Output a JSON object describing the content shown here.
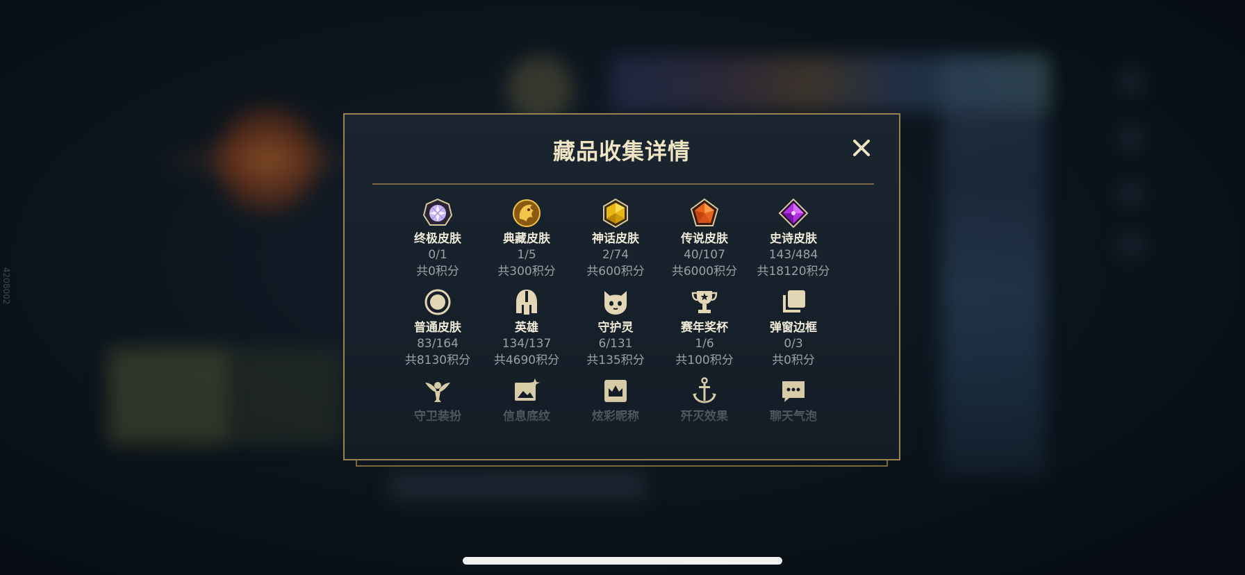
{
  "side_label": "4208002",
  "modal": {
    "title": "藏品收集详情",
    "close_icon": "close-icon"
  },
  "rows": [
    [
      {
        "icon": "ultimate-skin-gem-icon",
        "label": "终极皮肤",
        "count": "0/1",
        "points": "共0积分"
      },
      {
        "icon": "prestige-skin-dragon-icon",
        "label": "典藏皮肤",
        "count": "1/5",
        "points": "共300积分"
      },
      {
        "icon": "mythic-skin-gem-icon",
        "label": "神话皮肤",
        "count": "2/74",
        "points": "共600积分"
      },
      {
        "icon": "legendary-skin-gem-icon",
        "label": "传说皮肤",
        "count": "40/107",
        "points": "共6000积分"
      },
      {
        "icon": "epic-skin-gem-icon",
        "label": "史诗皮肤",
        "count": "143/484",
        "points": "共18120积分"
      }
    ],
    [
      {
        "icon": "standard-skin-circle-icon",
        "label": "普通皮肤",
        "count": "83/164",
        "points": "共8130积分"
      },
      {
        "icon": "champion-helmet-icon",
        "label": "英雄",
        "count": "134/137",
        "points": "共4690积分"
      },
      {
        "icon": "guardian-spirit-icon",
        "label": "守护灵",
        "count": "6/131",
        "points": "共135积分"
      },
      {
        "icon": "season-trophy-icon",
        "label": "赛年奖杯",
        "count": "1/6",
        "points": "共100积分"
      },
      {
        "icon": "popup-frame-icon",
        "label": "弹窗边框",
        "count": "0/3",
        "points": "共0积分"
      }
    ],
    [
      {
        "icon": "ward-skin-icon",
        "label": "守卫装扮"
      },
      {
        "icon": "banner-pattern-icon",
        "label": "信息底纹"
      },
      {
        "icon": "color-nickname-crown-icon",
        "label": "炫彩昵称"
      },
      {
        "icon": "elimination-effect-anchor-icon",
        "label": "歼灭效果"
      },
      {
        "icon": "chat-bubble-icon",
        "label": "聊天气泡"
      }
    ]
  ],
  "colors": {
    "gold_border": "#9b8350",
    "title": "#efe4c4",
    "label": "#f0ead8",
    "muted": "#9aa0a6"
  }
}
